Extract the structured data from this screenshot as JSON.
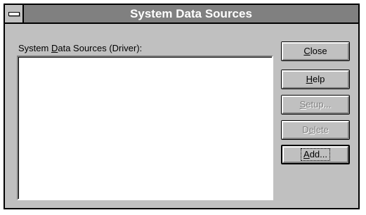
{
  "window": {
    "title": "System Data Sources"
  },
  "list": {
    "label_before": "System ",
    "label_accel": "D",
    "label_after": "ata Sources (Driver):",
    "items": []
  },
  "buttons": {
    "close": {
      "before": "",
      "accel": "C",
      "after": "lose",
      "enabled": true
    },
    "help": {
      "before": "",
      "accel": "H",
      "after": "elp",
      "enabled": true
    },
    "setup": {
      "before": "",
      "accel": "S",
      "after": "etup...",
      "enabled": false
    },
    "delete": {
      "before": "D",
      "accel": "e",
      "after": "lete",
      "enabled": false
    },
    "add": {
      "before": "",
      "accel": "A",
      "after": "dd...",
      "enabled": true,
      "default": true
    }
  },
  "colors": {
    "dialog_face": "#c0c0c0",
    "titlebar_inactive": "#808080",
    "title_text": "#ffffff",
    "disabled_text": "#808080"
  },
  "icons": {
    "system_menu": "system-menu-icon"
  }
}
